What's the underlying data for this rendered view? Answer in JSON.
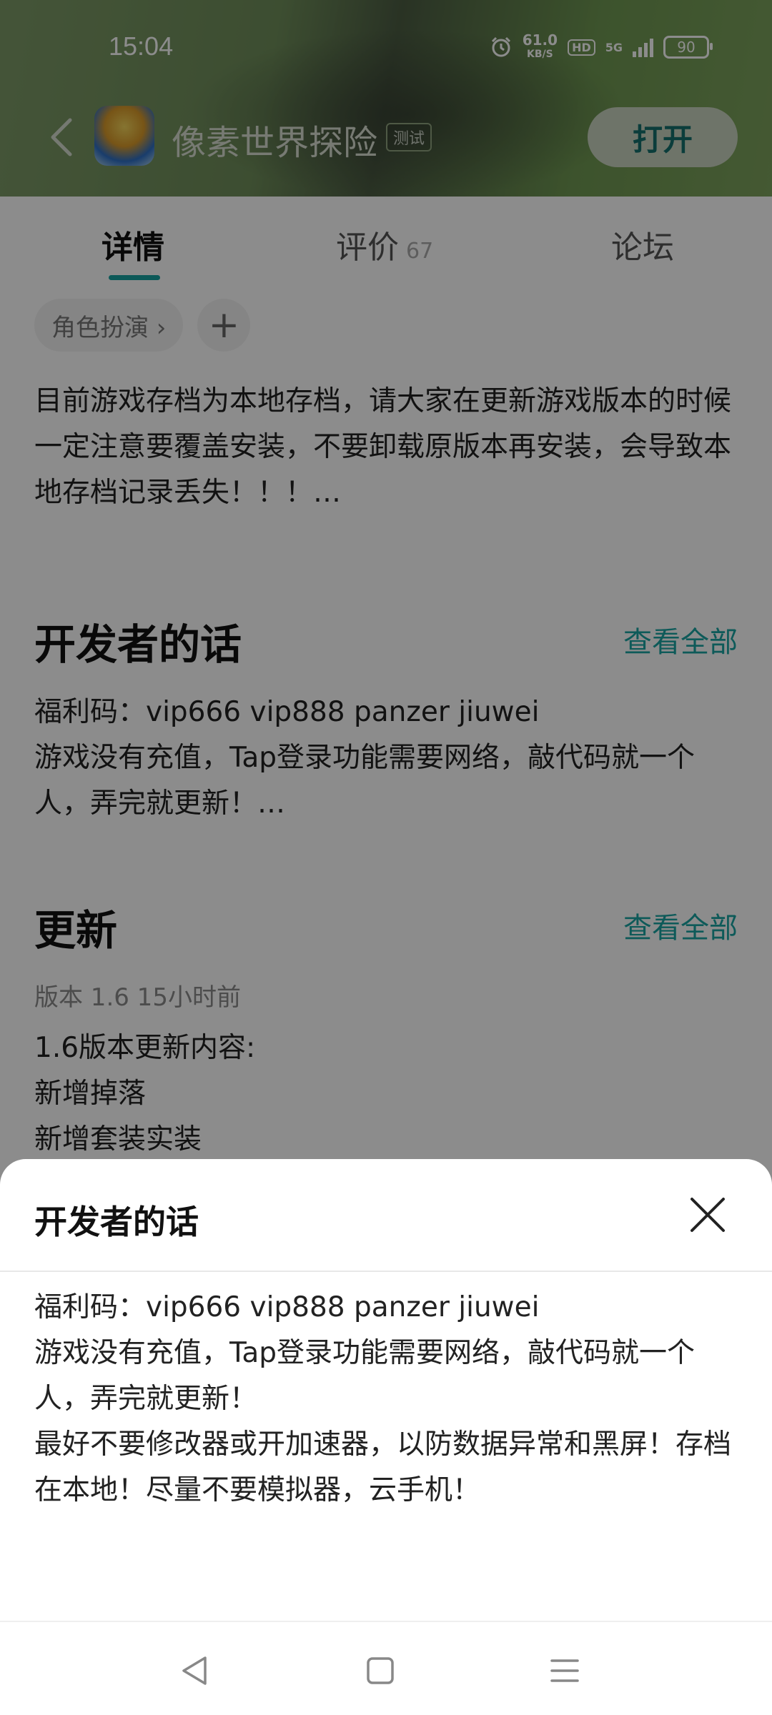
{
  "status_bar": {
    "time": "15:04",
    "net_speed": "61.0",
    "net_unit": "KB/S",
    "hd": "HD",
    "network": "5G",
    "battery": "90"
  },
  "header": {
    "app_title": "像素世界探险",
    "badge": "测试",
    "open_button": "打开"
  },
  "tabs": [
    {
      "label": "详情",
      "count": ""
    },
    {
      "label": "评价",
      "count": "67"
    },
    {
      "label": "论坛",
      "count": ""
    }
  ],
  "tags": [
    "角色扮演 ›",
    "+"
  ],
  "intro_text": "目前游戏存档为本地存档，请大家在更新游戏版本的时候一定注意要覆盖安装，不要卸载原版本再安装，会导致本地存档记录丢失！！！…",
  "developer": {
    "title": "开发者的话",
    "see_all": "查看全部",
    "line1": "福利码：vip666 vip888 panzer jiuwei",
    "line2": "游戏没有充值，Tap登录功能需要网络，敲代码就一个人，弄完就更新！…"
  },
  "update": {
    "title": "更新",
    "see_all": "查看全部",
    "meta": "版本 1.6   15小时前",
    "lines": [
      "1.6版本更新内容:",
      "新增掉落",
      "新增套装实装"
    ]
  },
  "sheet": {
    "title": "开发者的话",
    "lines": [
      "福利码：vip666 vip888 panzer jiuwei",
      "游戏没有充值，Tap登录功能需要网络，敲代码就一个人，弄完就更新！",
      "最好不要修改器或开加速器，以防数据异常和黑屏！存档在本地！尽量不要模拟器，云手机！"
    ]
  },
  "icons": {
    "back": "back-arrow-icon",
    "close": "close-icon",
    "nav_back": "triangle-back-icon",
    "nav_home": "square-home-icon",
    "nav_menu": "menu-icon"
  }
}
